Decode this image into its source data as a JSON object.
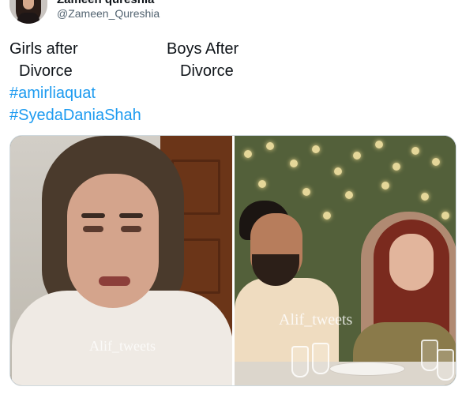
{
  "author": {
    "display_name": "Zameen qureshia",
    "handle": "@Zameen_Qureshia"
  },
  "tweet": {
    "left_caption": {
      "line1": "Girls after",
      "line2": "Divorce"
    },
    "right_caption": {
      "line1": "Boys After",
      "line2": "Divorce"
    },
    "hashtags": [
      "#amirliaquat",
      "#SyedaDaniaShah"
    ]
  },
  "media": {
    "left_photo": {
      "watermark": "Alif_tweets"
    },
    "right_photo": {
      "watermark": "Alif_tweets"
    }
  },
  "colors": {
    "link": "#1d9bf0",
    "text": "#0f1419",
    "secondary_text": "#536471",
    "border": "#cfd9de"
  }
}
